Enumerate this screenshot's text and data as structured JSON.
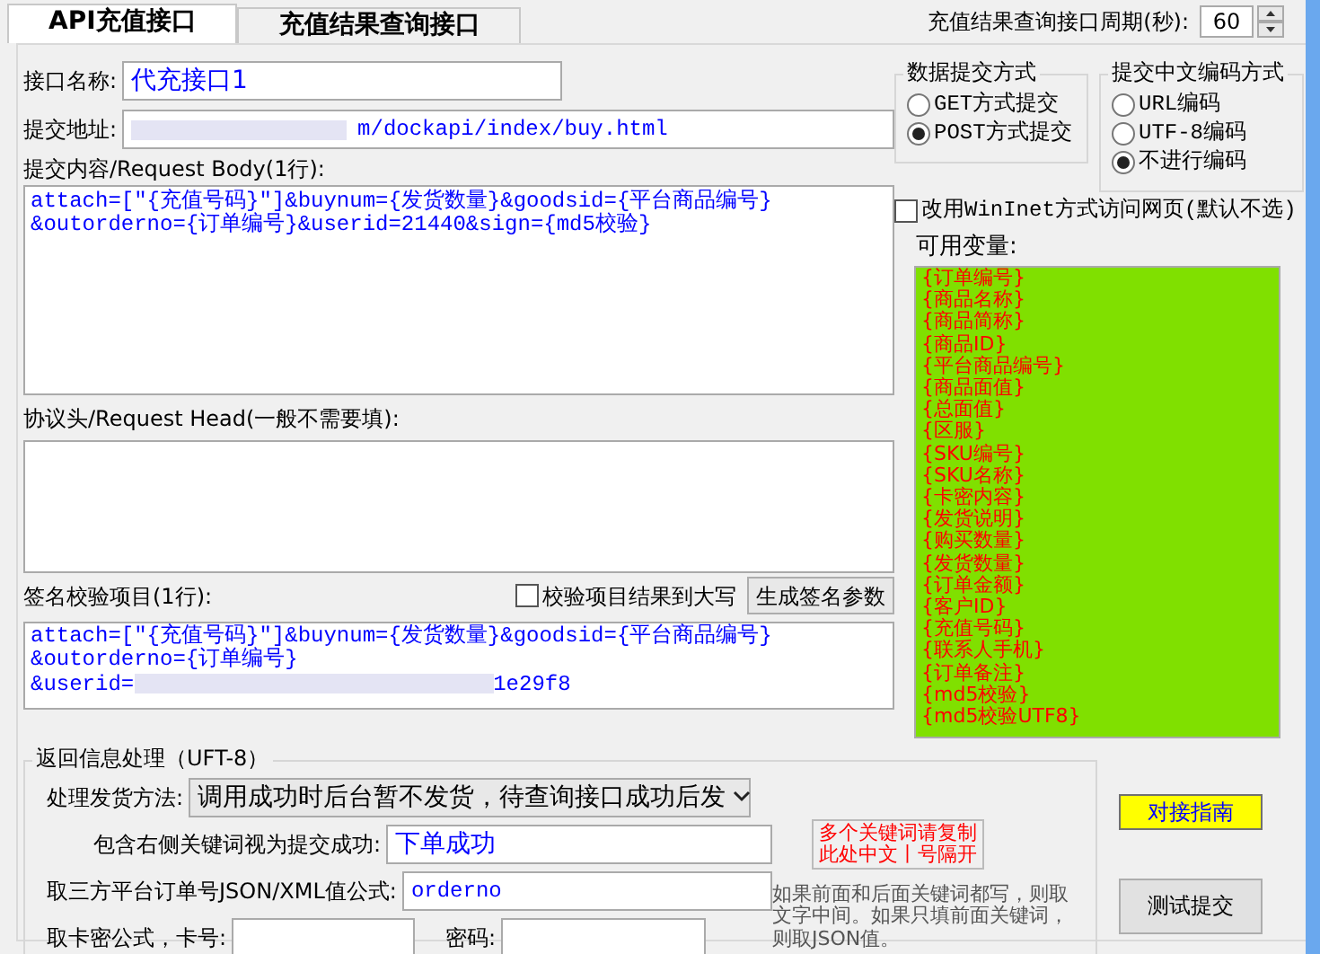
{
  "tabs": [
    {
      "label": "API充值接口",
      "selected": true
    },
    {
      "label": "充值结果查询接口",
      "selected": false
    }
  ],
  "query_period": {
    "label": "充值结果查询接口周期(秒):",
    "value": "60"
  },
  "form": {
    "name": {
      "label": "接口名称:",
      "value": "代充接口1"
    },
    "address": {
      "label": "提交地址:",
      "value": "m/dockapi/index/buy.html"
    },
    "body": {
      "label": "提交内容/Request Body(1行):",
      "value": "attach=[\"{充值号码}\"]&buynum={发货数量}&goodsid={平台商品编号}\n&outorderno={订单编号}&userid=21440&sign={md5校验}"
    },
    "head": {
      "label": "协议头/Request Head(一般不需要填):"
    },
    "sign": {
      "label": "签名校验项目(1行):",
      "uppercase": {
        "label": "校验项目结果到大写",
        "checked": false
      },
      "generate_button": "生成签名参数",
      "value_start": "attach=[\"{充值号码}\"]&buynum={发货数量}&goodsid={平台商品编号}\n&outorderno={订单编号}\n&userid=",
      "value_end": "1e29f8"
    }
  },
  "submit_method": {
    "title": "数据提交方式",
    "options": [
      {
        "label": "GET方式提交",
        "selected": false
      },
      {
        "label": "POST方式提交",
        "selected": true
      }
    ]
  },
  "encoding": {
    "title": "提交中文编码方式",
    "options": [
      {
        "label": "URL编码",
        "selected": false
      },
      {
        "label": "UTF-8编码",
        "selected": false
      },
      {
        "label": "不进行编码",
        "selected": true
      }
    ]
  },
  "wininet": {
    "label": "改用WinInet方式访问网页(默认不选)",
    "checked": false
  },
  "variables": {
    "label": "可用变量:",
    "items": [
      "{订单编号}",
      "{商品名称}",
      "{商品简称}",
      "{商品ID}",
      "{平台商品编号}",
      "{商品面值}",
      "{总面值}",
      "{区服}",
      "{SKU编号}",
      "{SKU名称}",
      "{卡密内容}",
      "{发货说明}",
      "{购买数量}",
      "{发货数量}",
      "{订单金额}",
      "{客户ID}",
      "{充值号码}",
      "{联系人手机}",
      "{订单备注}",
      "{md5校验}",
      "{md5校验UTF8}"
    ]
  },
  "response": {
    "title": "返回信息处理（UFT-8）",
    "delivery_method": {
      "label": "处理发货方法:",
      "value": "调用成功时后台暂不发货，待查询接口成功后发"
    },
    "success_keyword": {
      "label": "包含右侧关键词视为提交成功:",
      "value": "下单成功"
    },
    "order_formula": {
      "label": "取三方平台订单号JSON/XML值公式:",
      "value": "orderno"
    },
    "card": {
      "label": "取卡密公式，卡号:",
      "password_label": "密码:"
    },
    "keyword_note": "多个关键词请复制此处中文丨号隔开",
    "hint": "如果前面和后面关键词都写，则取文字中间。如果只填前面关键词，则取JSON值。"
  },
  "buttons": {
    "guide": "对接指南",
    "test": "测试提交"
  }
}
